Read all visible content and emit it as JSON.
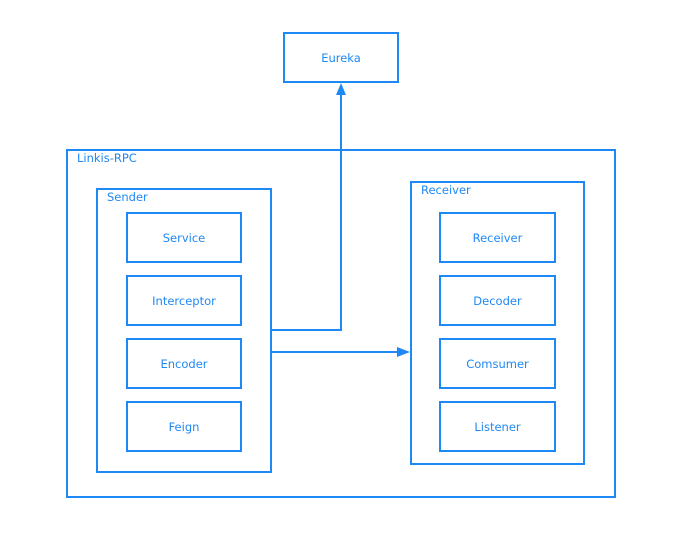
{
  "diagram": {
    "external": {
      "eureka": "Eureka"
    },
    "container": {
      "label": "Linkis-RPC",
      "sender": {
        "label": "Sender",
        "items": [
          "Service",
          "Interceptor",
          "Encoder",
          "Feign"
        ]
      },
      "receiver": {
        "label": "Receiver",
        "items": [
          "Receiver",
          "Decoder",
          "Comsumer",
          "Listener"
        ]
      }
    },
    "edges": [
      {
        "from": "Sender",
        "to": "Eureka"
      },
      {
        "from": "Sender",
        "to": "Receiver"
      }
    ],
    "colors": {
      "stroke": "#1e88f5",
      "text": "#1e88f5",
      "background": "#ffffff"
    }
  }
}
